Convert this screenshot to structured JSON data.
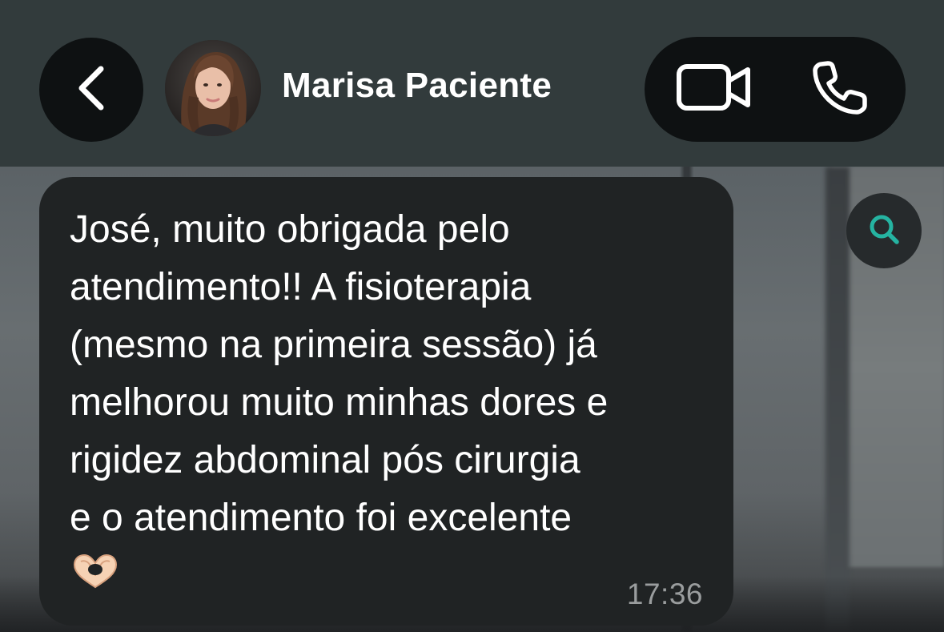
{
  "header": {
    "contact_name": "Marisa Paciente",
    "back_icon": "chevron-left-icon",
    "video_icon": "video-camera-icon",
    "phone_icon": "phone-icon"
  },
  "search": {
    "icon": "search-icon"
  },
  "message": {
    "text": "José, muito obrigada pelo\natendimento!! A fisioterapia\n(mesmo na primeira sessão) já\nmelhorou muito minhas dores e\nrigidez abdominal pós cirurgia\ne o atendimento foi excelente",
    "emoji": "🫶🏻",
    "time": "17:36"
  },
  "colors": {
    "header_bg": "#323b3c",
    "bubble_bg": "#202324",
    "accent_search": "#25b3a1",
    "timestamp": "#9a9d9e"
  }
}
